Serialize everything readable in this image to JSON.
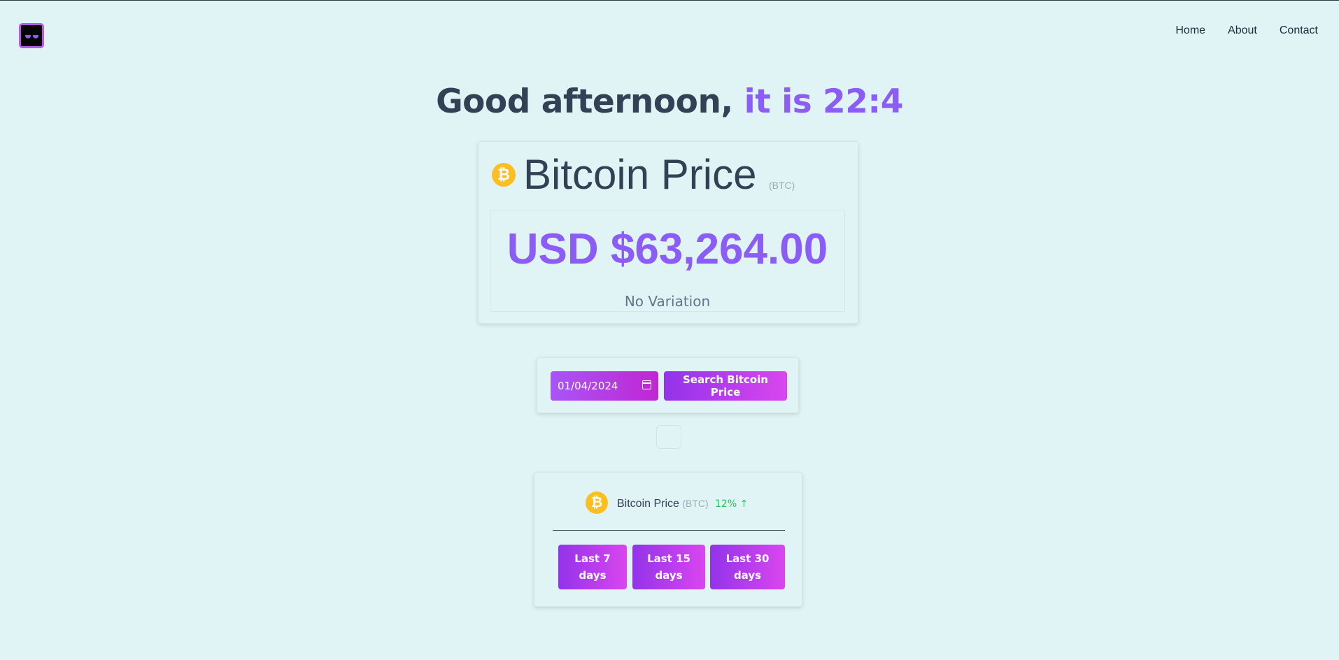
{
  "header": {
    "nav": [
      "Home",
      "About",
      "Contact"
    ]
  },
  "greeting": {
    "prefix": "Good afternoon,",
    "accent": "it is 22:4"
  },
  "price_card": {
    "coin_symbol": "₿",
    "title": "Bitcoin Price",
    "ticker": "(BTC)",
    "value": "USD $63,264.00",
    "variation": "No Variation"
  },
  "search": {
    "date_value": "01/04/2024",
    "button_label": "Search Bitcoin Price"
  },
  "history": {
    "coin_symbol": "₿",
    "title": "Bitcoin Price",
    "ticker": "(BTC)",
    "change": "12% ↑",
    "ranges": [
      "Last 7 days",
      "Last 15 days",
      "Last 30 days"
    ]
  },
  "colors": {
    "background": "#e0f4f6",
    "accent": "#8b5cf6",
    "positive": "#22c55e",
    "coin": "#fbbf24"
  }
}
